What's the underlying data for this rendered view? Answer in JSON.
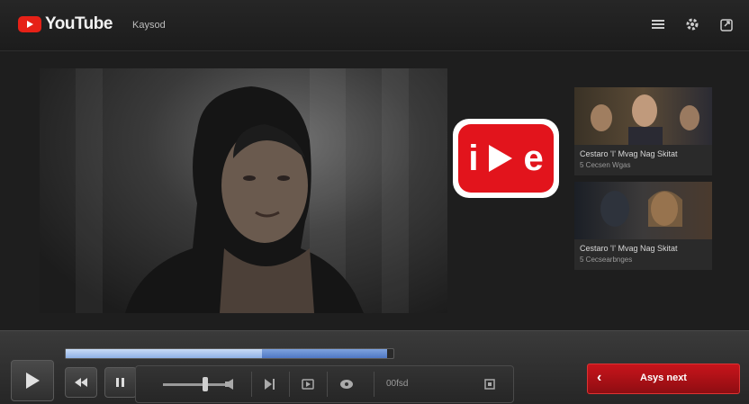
{
  "app": {
    "logo_text": "YouTube",
    "title": "Kaysod"
  },
  "player": {
    "progress": 0.6,
    "buffered": 0.98
  },
  "recommendations": [
    {
      "title": "Cestaro 'I' Mvag Nag Skitat",
      "subtitle": "5 Cecsen Wgas"
    },
    {
      "title": "Cestaro 'I' Mvag Nag Skitat",
      "subtitle": "5 Cecsearbnges"
    }
  ],
  "controls": {
    "volume_level": 0.5,
    "time_text": "00fsd",
    "next_label": "Asys next"
  },
  "colors": {
    "accent": "#e2141c",
    "progress": "#8fb1e6"
  },
  "icons": [
    "menu-icon",
    "gear-icon",
    "share-icon",
    "play-icon",
    "rewind-icon",
    "pause-icon",
    "speaker-icon",
    "skip-icon",
    "captions-icon",
    "settings-icon",
    "fullscreen-icon"
  ]
}
